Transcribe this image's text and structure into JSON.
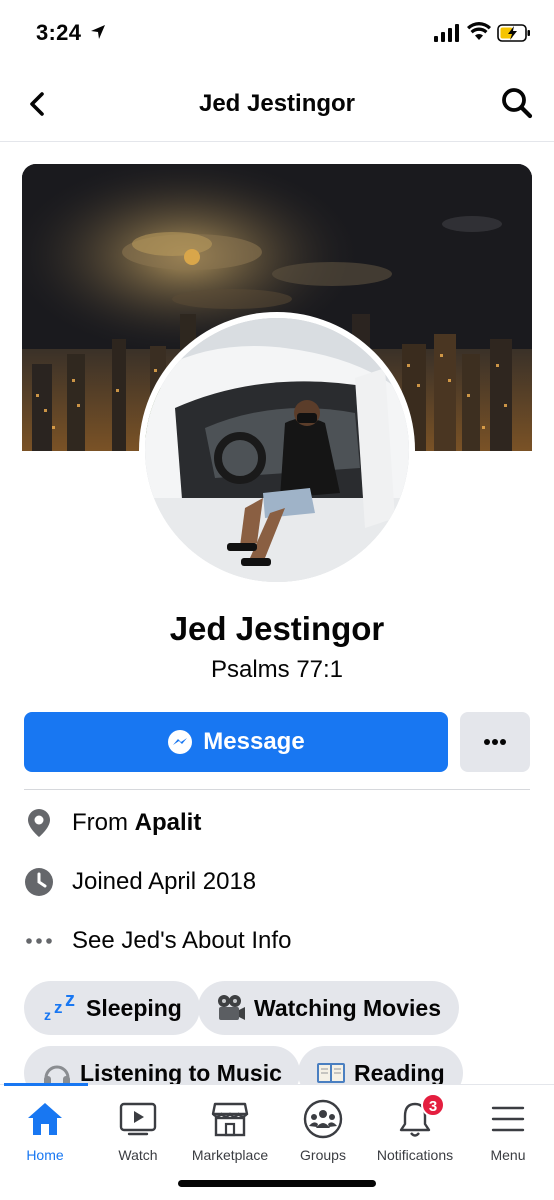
{
  "status_bar": {
    "time": "3:24"
  },
  "header": {
    "title": "Jed Jestingor",
    "back_icon": "chevron-left-icon",
    "search_icon": "search-icon"
  },
  "profile": {
    "name": "Jed Jestingor",
    "bio": "Psalms 77:1",
    "message_label": "Message",
    "more_icon": "more-horizontal-icon"
  },
  "info": {
    "from_prefix": "From",
    "from_place": "Apalit",
    "joined": "Joined April 2018",
    "about": "See Jed's About Info"
  },
  "hobbies": [
    {
      "label": "Sleeping",
      "icon": "zzz-icon"
    },
    {
      "label": "Watching Movies",
      "icon": "film-projector-icon"
    },
    {
      "label": "Listening to Music",
      "icon": "headphones-icon"
    },
    {
      "label": "Reading",
      "icon": "book-icon"
    }
  ],
  "tabs": [
    {
      "label": "Home",
      "active": true
    },
    {
      "label": "Watch"
    },
    {
      "label": "Marketplace"
    },
    {
      "label": "Groups"
    },
    {
      "label": "Notifications",
      "badge": "3"
    },
    {
      "label": "Menu"
    }
  ],
  "colors": {
    "accent": "#1877f2",
    "badge": "#e41e3f",
    "chip": "#e4e6eb"
  }
}
